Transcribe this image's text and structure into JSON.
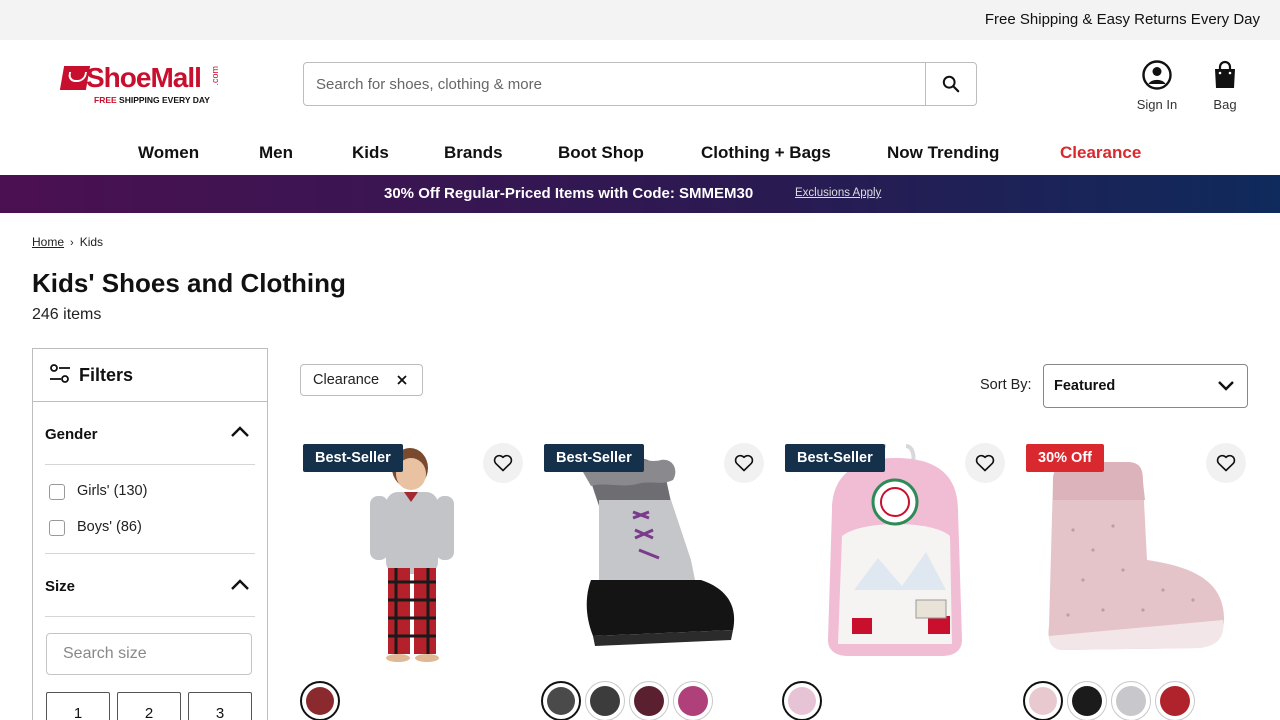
{
  "topbar": {
    "message": "Free Shipping & Easy Returns Every Day"
  },
  "logo": {
    "name": "ShoeMall",
    "dotcom": ".com",
    "tagline_free": "FREE",
    "tagline_rest": " SHIPPING EVERY DAY"
  },
  "search": {
    "placeholder": "Search for shoes, clothing & more",
    "value": ""
  },
  "account": {
    "signin_label": "Sign In",
    "bag_label": "Bag"
  },
  "nav": {
    "items": [
      "Women",
      "Men",
      "Kids",
      "Brands",
      "Boot Shop",
      "Clothing + Bags",
      "Now Trending",
      "Clearance"
    ]
  },
  "promo": {
    "text": "30% Off Regular-Priced Items with Code: SMMEM30",
    "link": "Exclusions Apply"
  },
  "breadcrumb": {
    "home": "Home",
    "current": "Kids"
  },
  "page": {
    "title": "Kids' Shoes and Clothing",
    "count": "246 items"
  },
  "filters": {
    "title": "Filters",
    "gender": {
      "title": "Gender",
      "options": [
        "Girls' (130)",
        "Boys' (86)"
      ]
    },
    "size": {
      "title": "Size",
      "search_placeholder": "Search size",
      "values": [
        "1",
        "2",
        "3"
      ]
    }
  },
  "active_filter": {
    "label": "Clearance"
  },
  "sort": {
    "label": "Sort By:",
    "value": "Featured"
  },
  "colors": {
    "accent_red": "#d9292f",
    "badge_navy": "#14304a",
    "promo_purple": "#4b1051"
  },
  "products": [
    {
      "badge": "Best-Seller",
      "badge_type": "bestseller",
      "swatches": [
        "#8a2a2e"
      ]
    },
    {
      "badge": "Best-Seller",
      "badge_type": "bestseller",
      "swatches": [
        "#4a4a4a",
        "#3c3c3c",
        "#5a2030",
        "#b0407a"
      ]
    },
    {
      "badge": "Best-Seller",
      "badge_type": "bestseller",
      "swatches": [
        "#e6c3d5"
      ]
    },
    {
      "badge": "30% Off",
      "badge_type": "sale",
      "swatches": [
        "#e8c9cf",
        "#1b1b1b",
        "#c8c8cc",
        "#b0222c"
      ]
    }
  ]
}
